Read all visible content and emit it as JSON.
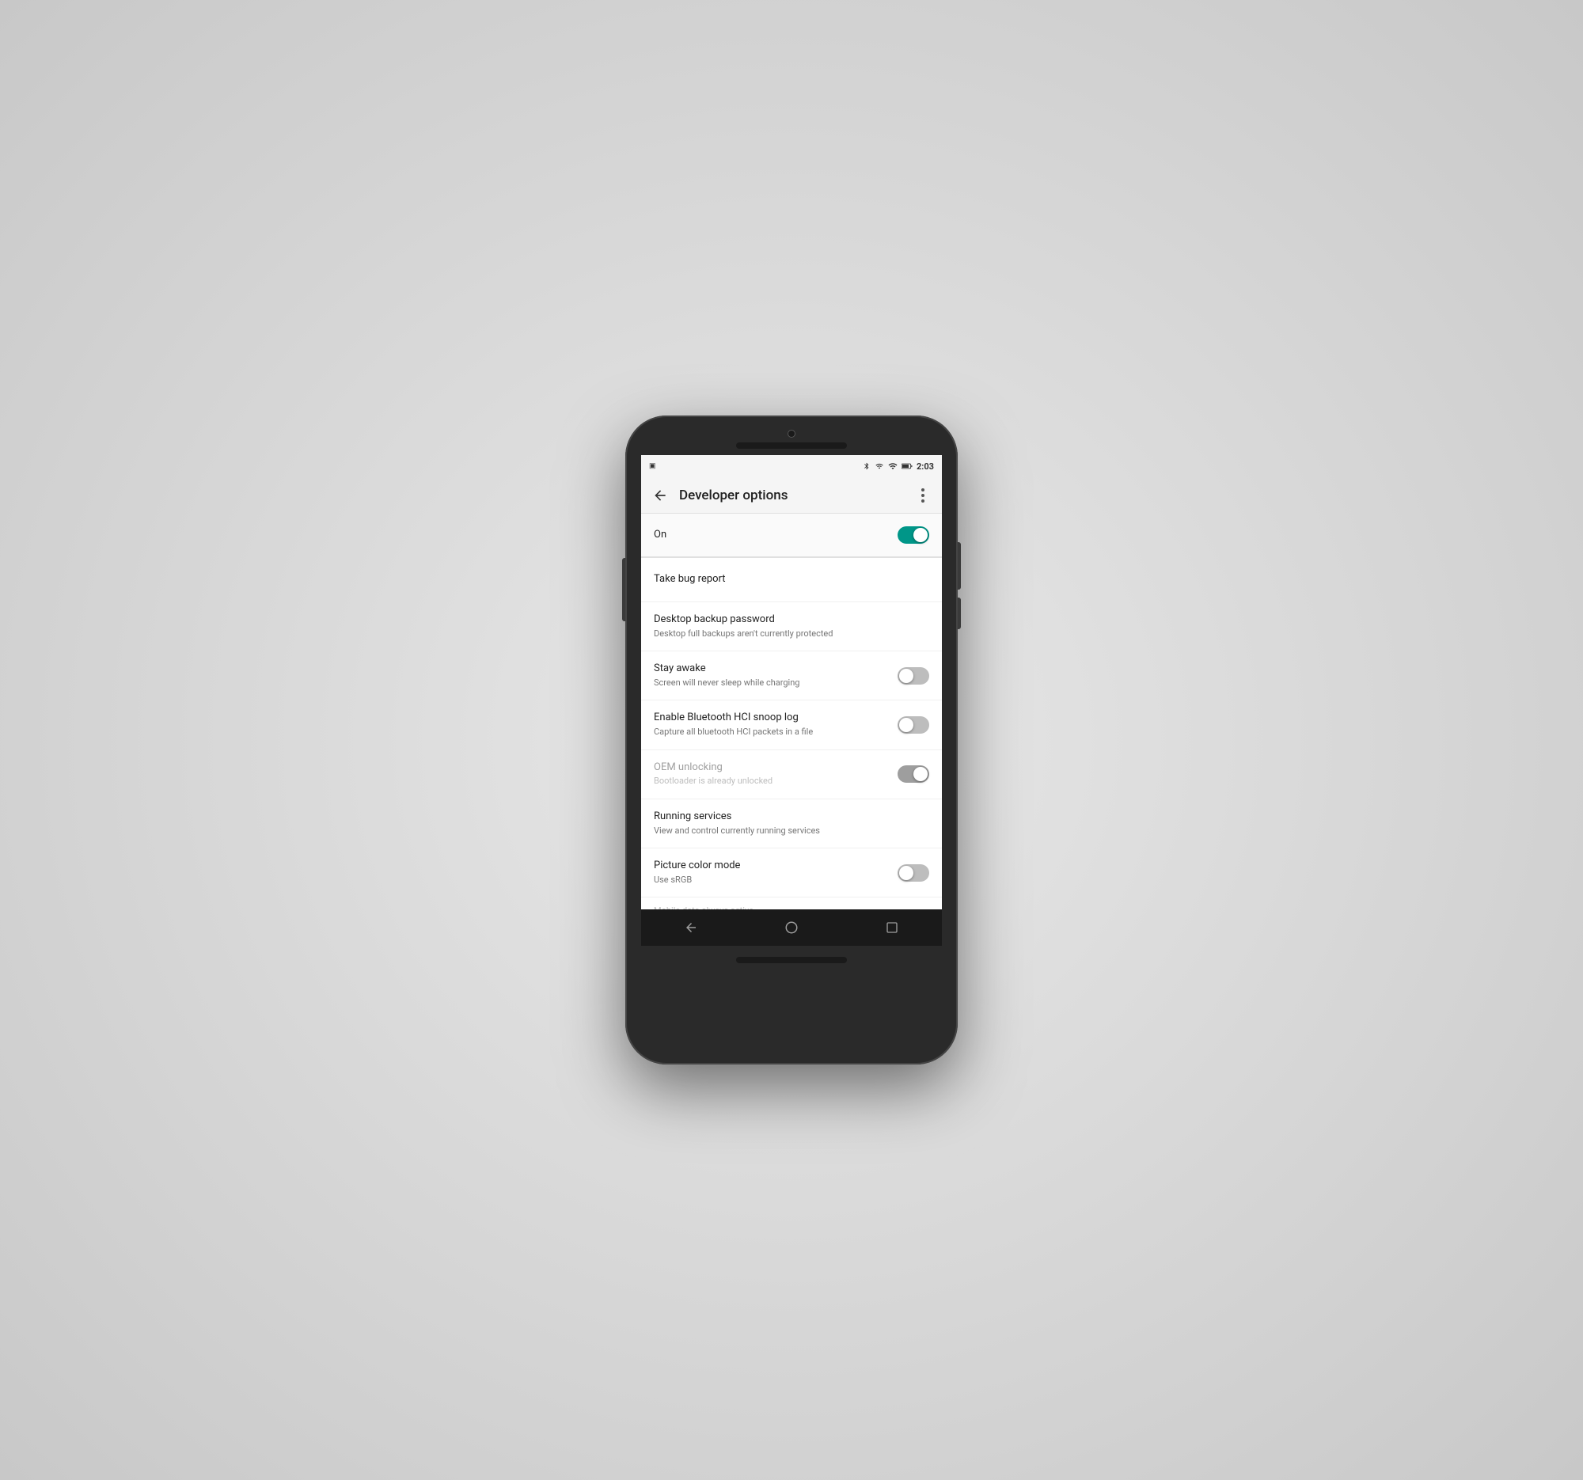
{
  "statusBar": {
    "time": "2:03",
    "icons": [
      "bluetooth",
      "wifi",
      "signal",
      "battery"
    ]
  },
  "toolbar": {
    "title": "Developer options",
    "backLabel": "←",
    "overflowLabel": "⋮"
  },
  "settings": {
    "toggle_on": {
      "label": "On",
      "state": "on"
    },
    "items": [
      {
        "id": "take-bug-report",
        "title": "Take bug report",
        "subtitle": "",
        "hasToggle": false,
        "toggleState": "",
        "disabled": false
      },
      {
        "id": "desktop-backup-password",
        "title": "Desktop backup password",
        "subtitle": "Desktop full backups aren't currently protected",
        "hasToggle": false,
        "toggleState": "",
        "disabled": false
      },
      {
        "id": "stay-awake",
        "title": "Stay awake",
        "subtitle": "Screen will never sleep while charging",
        "hasToggle": true,
        "toggleState": "off",
        "disabled": false
      },
      {
        "id": "bluetooth-hci",
        "title": "Enable Bluetooth HCI snoop log",
        "subtitle": "Capture all bluetooth HCI packets in a file",
        "hasToggle": true,
        "toggleState": "off",
        "disabled": false
      },
      {
        "id": "oem-unlocking",
        "title": "OEM unlocking",
        "subtitle": "Bootloader is already unlocked",
        "hasToggle": true,
        "toggleState": "disabled",
        "disabled": true
      },
      {
        "id": "running-services",
        "title": "Running services",
        "subtitle": "View and control currently running services",
        "hasToggle": false,
        "toggleState": "",
        "disabled": false
      },
      {
        "id": "picture-color-mode",
        "title": "Picture color mode",
        "subtitle": "Use sRGB",
        "hasToggle": true,
        "toggleState": "off",
        "disabled": false
      }
    ],
    "truncatedHint": "Mobile data always active..."
  },
  "navBar": {
    "back": "back",
    "home": "home",
    "recents": "recents"
  }
}
